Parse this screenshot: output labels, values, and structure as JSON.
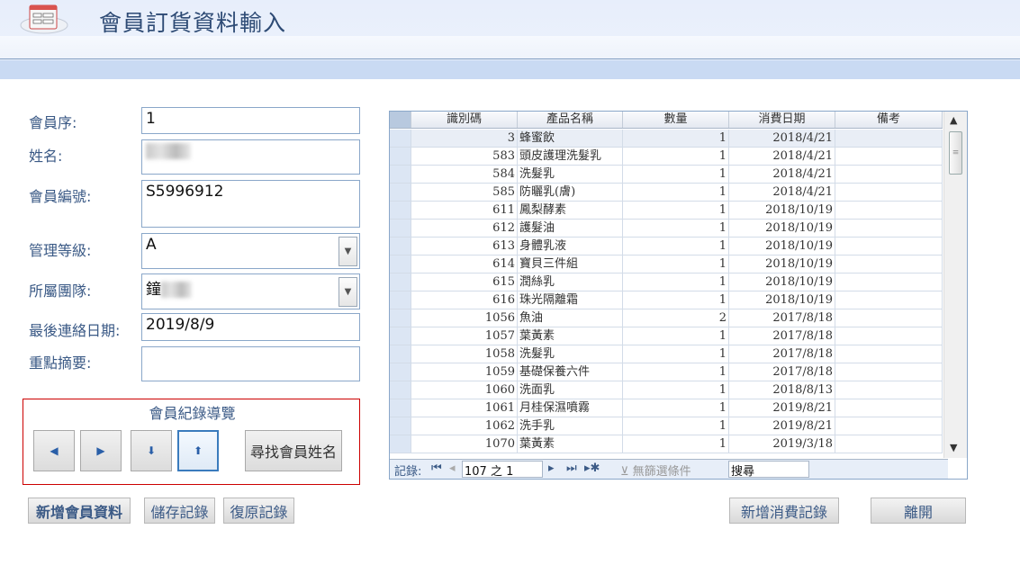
{
  "header": {
    "title": "會員訂貨資料輸入",
    "logo_icon": "form-icon"
  },
  "form": {
    "member_seq": {
      "label": "會員序:",
      "value": "1"
    },
    "name": {
      "label": "姓名:"
    },
    "member_id": {
      "label": "會員編號:",
      "value": "S5996912"
    },
    "level": {
      "label": "管理等級:",
      "value": "A"
    },
    "team": {
      "label": "所屬團隊:",
      "value": "鐘"
    },
    "last_contact": {
      "label": "最後連絡日期:",
      "value": "2019/8/9"
    },
    "summary": {
      "label": "重點摘要:",
      "value": ""
    }
  },
  "nav_box": {
    "title": "會員紀錄導覽",
    "buttons": [
      "prev-record",
      "next-record",
      "last-record",
      "first-record"
    ],
    "find_label": "尋找會員姓名"
  },
  "buttons": {
    "add_member": "新增會員資料",
    "save": "儲存記錄",
    "undo": "復原記錄",
    "add_purchase": "新增消費記錄",
    "exit": "離開"
  },
  "grid": {
    "columns": [
      "識別碼",
      "產品名稱",
      "數量",
      "消費日期",
      "備考"
    ],
    "rows": [
      [
        "3",
        "蜂蜜飲",
        "1",
        "2018/4/21",
        ""
      ],
      [
        "583",
        "頭皮護理洗髮乳",
        "1",
        "2018/4/21",
        ""
      ],
      [
        "584",
        "洗髮乳",
        "1",
        "2018/4/21",
        ""
      ],
      [
        "585",
        "防曬乳(膚)",
        "1",
        "2018/4/21",
        ""
      ],
      [
        "611",
        "鳳梨酵素",
        "1",
        "2018/10/19",
        ""
      ],
      [
        "612",
        "護髮油",
        "1",
        "2018/10/19",
        ""
      ],
      [
        "613",
        "身體乳液",
        "1",
        "2018/10/19",
        ""
      ],
      [
        "614",
        "寶貝三件組",
        "1",
        "2018/10/19",
        ""
      ],
      [
        "615",
        "潤絲乳",
        "1",
        "2018/10/19",
        ""
      ],
      [
        "616",
        "珠光隔離霜",
        "1",
        "2018/10/19",
        ""
      ],
      [
        "1056",
        "魚油",
        "2",
        "2017/8/18",
        ""
      ],
      [
        "1057",
        "葉黃素",
        "1",
        "2017/8/18",
        ""
      ],
      [
        "1058",
        "洗髮乳",
        "1",
        "2017/8/18",
        ""
      ],
      [
        "1059",
        "基礎保養六件",
        "1",
        "2017/8/18",
        ""
      ],
      [
        "1060",
        " 洗面乳",
        "1",
        "2018/8/13",
        ""
      ],
      [
        "1061",
        "月桂保濕噴霧",
        "1",
        "2019/8/21",
        ""
      ],
      [
        "1062",
        "洗手乳",
        "1",
        "2019/8/21",
        ""
      ],
      [
        "1070",
        "葉黃素",
        "1",
        "2019/3/18",
        ""
      ]
    ],
    "nav": {
      "label": "記錄:",
      "position": "107 之 1",
      "no_filter": "無篩選條件",
      "search": "搜尋"
    }
  }
}
